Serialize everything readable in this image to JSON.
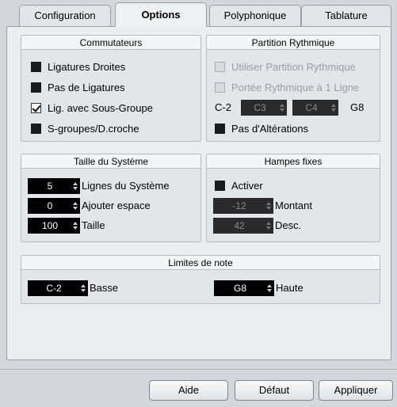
{
  "tabs": [
    {
      "label": "Configuration"
    },
    {
      "label": "Options"
    },
    {
      "label": "Polyphonique"
    },
    {
      "label": "Tablature"
    }
  ],
  "commutateurs": {
    "title": "Commutateurs",
    "items": [
      {
        "label": "Ligatures Droites",
        "checked": false
      },
      {
        "label": "Pas de Ligatures",
        "checked": false
      },
      {
        "label": "Lig. avec Sous-Groupe",
        "checked": true
      },
      {
        "label": "S-groupes/D.croche",
        "checked": false
      }
    ]
  },
  "partition": {
    "title": "Partition Rythmique",
    "use_label": "Utiliser Partition Rythmique",
    "portee_label": "Portée Rythmique à 1 Ligne",
    "low_label": "C-2",
    "low_value": "C3",
    "high_value": "C4",
    "high_label": "G8",
    "alterations_label": "Pas d'Altérations"
  },
  "taille": {
    "title": "Taille du Système",
    "rows": [
      {
        "value": "5",
        "label": "Lignes du Système"
      },
      {
        "value": "0",
        "label": "Ajouter espace"
      },
      {
        "value": "100",
        "label": "Taille"
      }
    ]
  },
  "hampes": {
    "title": "Hampes fixes",
    "activer_label": "Activer",
    "rows": [
      {
        "value": "-12",
        "label": "Montant"
      },
      {
        "value": "42",
        "label": "Desc."
      }
    ]
  },
  "limites": {
    "title": "Limites de note",
    "basse_value": "C-2",
    "basse_label": "Basse",
    "haute_value": "G8",
    "haute_label": "Haute"
  },
  "buttons": {
    "aide": "Aide",
    "defaut": "Défaut",
    "appliquer": "Appliquer"
  }
}
